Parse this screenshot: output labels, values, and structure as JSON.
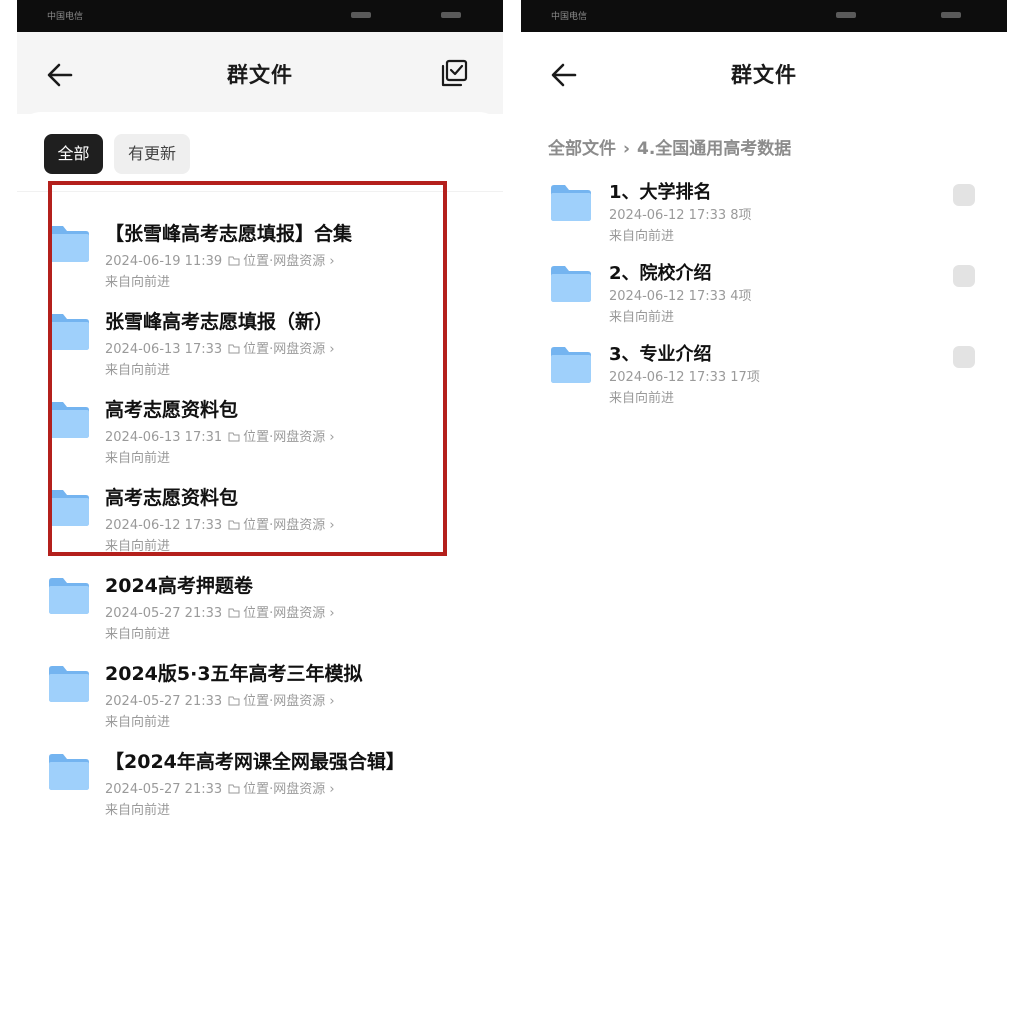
{
  "left": {
    "status_bar": {
      "carrier": "中国电信"
    },
    "header": {
      "title": "群文件",
      "back_icon": "arrow-left-icon",
      "select_icon": "multi-select-icon"
    },
    "filters": [
      {
        "label": "全部",
        "active": true
      },
      {
        "label": "有更新",
        "active": false
      }
    ],
    "files": [
      {
        "name": "【张雪峰高考志愿填报】合集",
        "time": "2024-06-19 11:39",
        "location": "位置·网盘资源",
        "from": "来自向前进"
      },
      {
        "name": "张雪峰高考志愿填报（新）",
        "time": "2024-06-13 17:33",
        "location": "位置·网盘资源",
        "from": "来自向前进"
      },
      {
        "name": "高考志愿资料包",
        "time": "2024-06-13 17:31",
        "location": "位置·网盘资源",
        "from": "来自向前进"
      },
      {
        "name": "高考志愿资料包",
        "time": "2024-06-12 17:33",
        "location": "位置·网盘资源",
        "from": "来自向前进"
      },
      {
        "name": "2024高考押题卷",
        "time": "2024-05-27 21:33",
        "location": "位置·网盘资源",
        "from": "来自向前进"
      },
      {
        "name": "2024版5·3五年高考三年模拟",
        "time": "2024-05-27 21:33",
        "location": "位置·网盘资源",
        "from": "来自向前进"
      },
      {
        "name": "【2024年高考网课全网最强合辑】",
        "time": "2024-05-27 21:33",
        "location": "位置·网盘资源",
        "from": "来自向前进"
      }
    ],
    "highlight_color": "#b4201c"
  },
  "right": {
    "status_bar": {
      "carrier": "中国电信"
    },
    "header": {
      "title": "群文件",
      "back_icon": "arrow-left-icon"
    },
    "breadcrumb": {
      "root": "全部文件",
      "current": "4.全国通用高考数据"
    },
    "folders": [
      {
        "name": "1、大学排名",
        "meta": "2024-06-12 17:33 8项",
        "from": "来自向前进"
      },
      {
        "name": "2、院校介绍",
        "meta": "2024-06-12 17:33 4项",
        "from": "来自向前进"
      },
      {
        "name": "3、专业介绍",
        "meta": "2024-06-12 17:33 17项",
        "from": "来自向前进"
      }
    ]
  },
  "colors": {
    "folder_blue": "#8cc4f5",
    "chip_active": "#1f1f1f",
    "meta_gray": "#9a9a9a"
  }
}
